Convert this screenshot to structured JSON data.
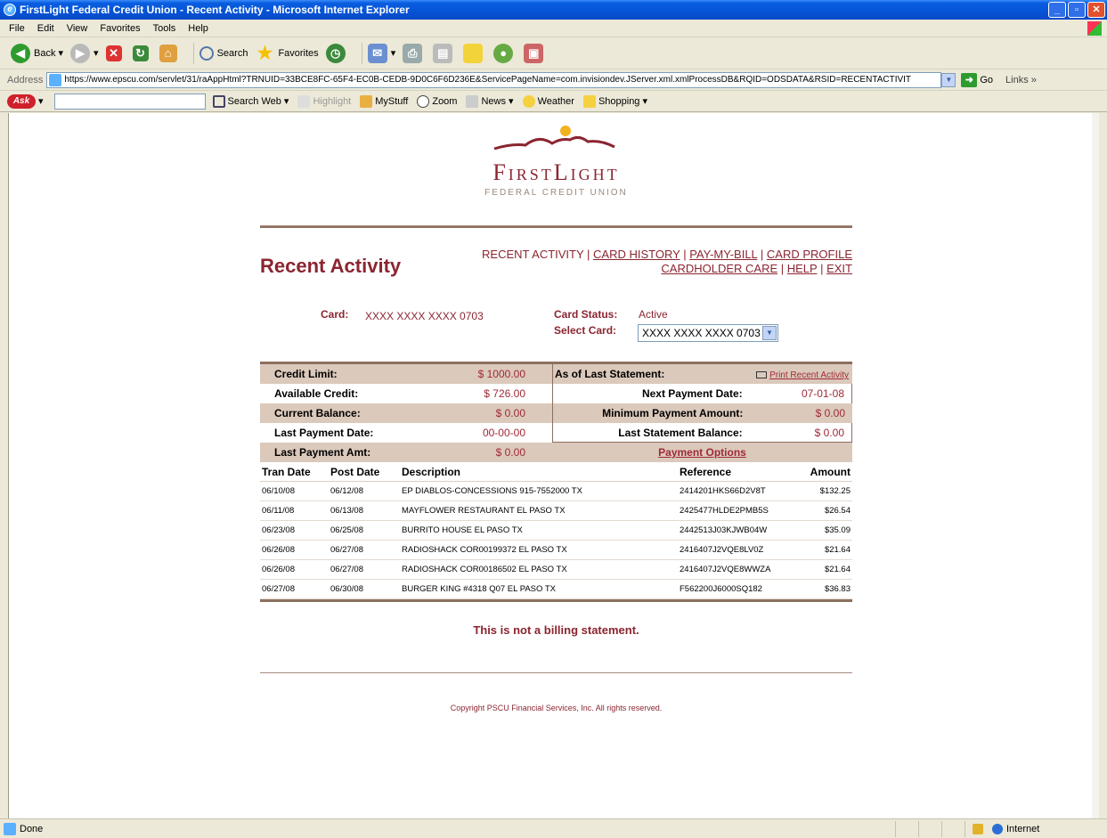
{
  "window": {
    "title": "FirstLight Federal Credit Union - Recent Activity - Microsoft Internet Explorer"
  },
  "menu": [
    "File",
    "Edit",
    "View",
    "Favorites",
    "Tools",
    "Help"
  ],
  "toolbar": {
    "back": "Back",
    "search": "Search",
    "favorites": "Favorites"
  },
  "address": {
    "label": "Address",
    "url": "https://www.epscu.com/servlet/31/raAppHtml?TRNUID=33BCE8FC-65F4-EC0B-CEDB-9D0C6F6D236E&ServicePageName=com.invisiondev.JServer.xml.xmlProcessDB&RQID=ODSDATA&RSID=RECENTACTIVIT",
    "go": "Go",
    "links": "Links"
  },
  "ask": {
    "logo": "Ask",
    "search_web": "Search Web",
    "highlight": "Highlight",
    "mystuff": "MyStuff",
    "zoom": "Zoom",
    "news": "News",
    "weather": "Weather",
    "shopping": "Shopping"
  },
  "brand": {
    "name": "FirstLight",
    "tagline": "FEDERAL CREDIT UNION",
    "accent": "#8b2530"
  },
  "page": {
    "title": "Recent Activity",
    "nav": {
      "recent": "RECENT ACTIVITY",
      "sep": " | ",
      "card_history": "CARD HISTORY",
      "pay_my_bill": "PAY-MY-BILL",
      "card_profile": "CARD PROFILE",
      "cardholder_care": "CARDHOLDER CARE",
      "help": "HELP",
      "exit": "EXIT"
    }
  },
  "card": {
    "label": "Card:",
    "number": "XXXX XXXX XXXX 0703",
    "status_label": "Card Status:",
    "status_value": "Active",
    "select_label": "Select Card:",
    "selected": "XXXX XXXX XXXX 0703"
  },
  "summary": {
    "credit_limit_label": "Credit Limit:",
    "credit_limit": "$ 1000.00",
    "as_of_label": "As of Last Statement:",
    "print_link": "Print Recent Activity",
    "available_label": "Available Credit:",
    "available": "$ 726.00",
    "next_payment_label": "Next Payment Date:",
    "next_payment": "07-01-08",
    "balance_label": "Current Balance:",
    "balance": "$ 0.00",
    "min_payment_label": "Minimum Payment Amount:",
    "min_payment": "$ 0.00",
    "last_payment_date_label": "Last Payment Date:",
    "last_payment_date": "00-00-00",
    "last_statement_label": "Last Statement Balance:",
    "last_statement": "$ 0.00",
    "last_payment_amt_label": "Last Payment Amt:",
    "last_payment_amt": "$ 0.00",
    "payment_options": "Payment Options"
  },
  "transactions": {
    "headers": [
      "Tran Date",
      "Post Date",
      "Description",
      "Reference",
      "Amount"
    ],
    "rows": [
      [
        "06/10/08",
        "06/12/08",
        "EP DIABLOS-CONCESSIONS 915-7552000 TX",
        "2414201HKS66D2V8T",
        "$132.25"
      ],
      [
        "06/11/08",
        "06/13/08",
        "MAYFLOWER RESTAURANT EL PASO TX",
        "2425477HLDE2PMB5S",
        "$26.54"
      ],
      [
        "06/23/08",
        "06/25/08",
        "BURRITO HOUSE EL PASO TX",
        "2442513J03KJWB04W",
        "$35.09"
      ],
      [
        "06/26/08",
        "06/27/08",
        "RADIOSHACK COR00199372 EL PASO TX",
        "2416407J2VQE8LV0Z",
        "$21.64"
      ],
      [
        "06/26/08",
        "06/27/08",
        "RADIOSHACK COR00186502 EL PASO TX",
        "2416407J2VQE8WWZA",
        "$21.64"
      ],
      [
        "06/27/08",
        "06/30/08",
        "BURGER KING #4318 Q07 EL PASO TX",
        "F562200J6000SQ182",
        "$36.83"
      ]
    ]
  },
  "notice": "This is not a billing statement.",
  "copyright": "Copyright PSCU Financial Services, Inc. All rights reserved.",
  "status": {
    "left": "Done",
    "zone": "Internet"
  }
}
